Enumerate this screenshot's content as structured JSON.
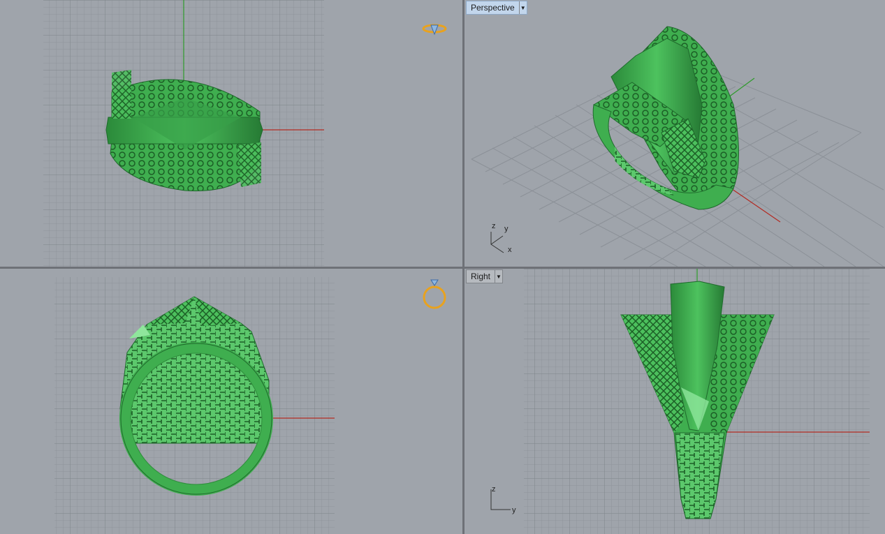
{
  "app": "Rhino 3D viewports",
  "viewports": {
    "top": {
      "title": "",
      "axis_x": "",
      "axis_y": ""
    },
    "perspective": {
      "title": "Perspective",
      "axis_x": "x",
      "axis_y": "y",
      "axis_z": "z",
      "active": true
    },
    "front": {
      "title": ""
    },
    "right": {
      "title": "Right",
      "axis_y": "y",
      "axis_z": "z"
    }
  },
  "colors": {
    "background": "#9fa4ab",
    "grid": "#8a8f96",
    "grid_major": "#7b8087",
    "axis_x": "#b32a22",
    "axis_y": "#2d9b2a",
    "model": "#3fae4f",
    "model_highlight": "#8fe69c",
    "model_shadow": "#1f6a2c",
    "active_title": "#c2d6ec",
    "icon": "#e8a21f"
  },
  "icons": {
    "top_view_icon": "ring-top-icon",
    "front_view_icon": "ring-front-icon"
  }
}
